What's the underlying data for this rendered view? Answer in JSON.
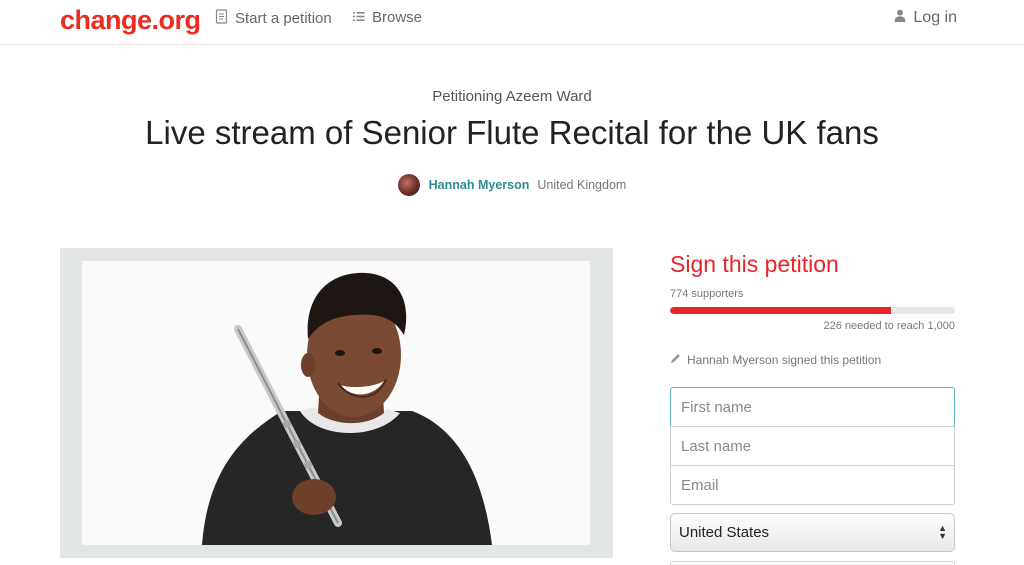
{
  "header": {
    "logo": "change.org",
    "nav": {
      "start_petition": "Start a petition",
      "browse": "Browse",
      "login": "Log in"
    }
  },
  "petition": {
    "petitioning": "Petitioning Azeem Ward",
    "title": "Live stream of Senior Flute Recital for the UK fans",
    "author_name": "Hannah Myerson",
    "author_location": "United Kingdom"
  },
  "sign_panel": {
    "heading": "Sign this petition",
    "supporters": "774 supporters",
    "progress_fraction": 0.774,
    "needed": "226 needed to reach 1,000",
    "recent_signer": "Hannah Myerson signed this petition",
    "form": {
      "first_name_placeholder": "First name",
      "last_name_placeholder": "Last name",
      "email_placeholder": "Email",
      "country_value": "United States"
    }
  },
  "colors": {
    "brand": "#ec2c22",
    "accent_teal": "#2e8c94",
    "focus_border": "#5fb7c3"
  },
  "icons": {
    "start_petition": "document-icon",
    "browse": "list-icon",
    "login": "user-icon",
    "signed": "pencil-icon"
  }
}
